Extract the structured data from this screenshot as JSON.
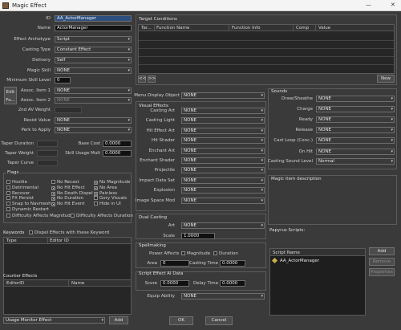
{
  "window": {
    "title": "Magic Effect",
    "minimize": "—",
    "close": "✕"
  },
  "fields": {
    "id": "AA_ActorManager",
    "name": "ActorManager",
    "effect_archetype": "Script",
    "casting_type": "Constant Effect",
    "delivery": "Self",
    "magic_skill": "NONE",
    "min_skill_level": "0",
    "assoc_item1": "NONE",
    "assoc_item2": "NONE",
    "resist_value": "NONE",
    "perk_to_apply": "NONE",
    "base_cost": "0.0000",
    "skill_usage_mult": "0.0000",
    "counter_dropdown": "Usage Monitor Effect"
  },
  "labels": {
    "id": "ID",
    "name": "Name",
    "effect_archetype": "Effect Archetype",
    "casting_type": "Casting Type",
    "delivery": "Delivery",
    "magic_skill": "Magic Skill",
    "min_skill_level": "Minimum Skill Level",
    "assoc_item1": "Assoc. Item 1",
    "assoc_item2": "Assoc. Item 2",
    "edit_form": "Edit Fo...",
    "second_av_weight": "2nd AV Weight",
    "resist_value": "Resist Value",
    "perk_to_apply": "Perk to Apply",
    "taper_duration": "Taper Duration",
    "taper_weight": "Taper Weight",
    "taper_curve": "Taper Curve",
    "base_cost": "Base Cost",
    "skill_usage_mult": "Skill Usage Mult"
  },
  "flags": {
    "title": "Flags",
    "items": [
      {
        "label": "Hostile",
        "checked": false
      },
      {
        "label": "No Recast",
        "checked": false
      },
      {
        "label": "No Magnitude",
        "checked": true
      },
      {
        "label": "Detrimental",
        "checked": false
      },
      {
        "label": "No Hit Effect",
        "checked": true
      },
      {
        "label": "No Area",
        "checked": true
      },
      {
        "label": "Recover",
        "checked": false
      },
      {
        "label": "No Death Dispel",
        "checked": true
      },
      {
        "label": "Painless",
        "checked": true
      },
      {
        "label": "FX Persist",
        "checked": false
      },
      {
        "label": "No Duration",
        "checked": true
      },
      {
        "label": "Gory Visuals",
        "checked": false
      },
      {
        "label": "Snap to Navmesh",
        "checked": false
      },
      {
        "label": "No Hit Event",
        "checked": true
      },
      {
        "label": "Hide in UI",
        "checked": false
      },
      {
        "label": "Dynamic Restart",
        "checked": false
      },
      {
        "label": "Difficulty Affects Magnitude",
        "checked": false
      },
      {
        "label": "Difficulty Affects Duration",
        "checked": false
      }
    ]
  },
  "keywords": {
    "title": "Keywords",
    "dispel_label": "Dispel Effects with these Keyword",
    "columns": [
      "Type",
      "Editor ID"
    ]
  },
  "counter_effects": {
    "title": "Counter Effects",
    "columns": [
      "EditorID",
      "Name"
    ],
    "add": "Add"
  },
  "target_conditions": {
    "title": "Target Conditions",
    "columns": [
      "Tar...",
      "Function Name",
      "Function Info",
      "Comp",
      "Value"
    ],
    "prev": "<<",
    "next": ">>",
    "new": "New"
  },
  "menu_display": {
    "label": "Menu Display Object",
    "value": "NONE"
  },
  "visual_effects": {
    "title": "Visual Effects",
    "rows": [
      {
        "label": "Casting Art",
        "value": "NONE"
      },
      {
        "label": "Casting Light",
        "value": "NONE"
      },
      {
        "label": "Hit Effect Art",
        "value": "NONE"
      },
      {
        "label": "Hit Shader",
        "value": "NONE"
      },
      {
        "label": "Enchant Art",
        "value": "NONE"
      },
      {
        "label": "Enchant Shader",
        "value": "NONE"
      },
      {
        "label": "Projectile",
        "value": "NONE"
      },
      {
        "label": "Impact Data Set",
        "value": "NONE"
      },
      {
        "label": "Explosion",
        "value": "NONE"
      },
      {
        "label": "Image Space Mod",
        "value": "NONE"
      }
    ]
  },
  "dual_casting": {
    "title": "Dual Casting",
    "art_label": "Art",
    "art_value": "NONE",
    "scale_label": "Scale",
    "scale_value": "1.0000"
  },
  "spellmaking": {
    "title": "Spellmaking",
    "power_affects": "Power Affects",
    "magnitude": "Magnitude",
    "duration": "Duration",
    "area_label": "Area",
    "area_value": "0",
    "casting_time_label": "Casting Time",
    "casting_time_value": "0.0000"
  },
  "script_effect_ai": {
    "title": "Script Effect AI Data",
    "score_label": "Score",
    "score_value": "0.0000",
    "delay_label": "Delay Time",
    "delay_value": "0.0000"
  },
  "equip_ability": {
    "label": "Equip Ability",
    "value": "NONE"
  },
  "sounds": {
    "title": "Sounds",
    "rows": [
      {
        "label": "Draw/Sheathe",
        "value": "NONE"
      },
      {
        "label": "Charge",
        "value": "NONE"
      },
      {
        "label": "Ready",
        "value": "NONE"
      },
      {
        "label": "Release",
        "value": "NONE"
      },
      {
        "label": "Cast Loop (Conc.)",
        "value": "NONE"
      },
      {
        "label": "On Hit",
        "value": "NONE"
      }
    ],
    "level_label": "Casting Sound Level",
    "level_value": "Normal"
  },
  "description": {
    "title": "Magic item description"
  },
  "papyrus": {
    "title": "Papyrus Scripts:",
    "column": "Script Name",
    "script": "AA_ActorManager",
    "add": "Add",
    "remove": "Remove",
    "properties": "Properties"
  },
  "footer": {
    "ok": "OK",
    "cancel": "Cancel"
  }
}
